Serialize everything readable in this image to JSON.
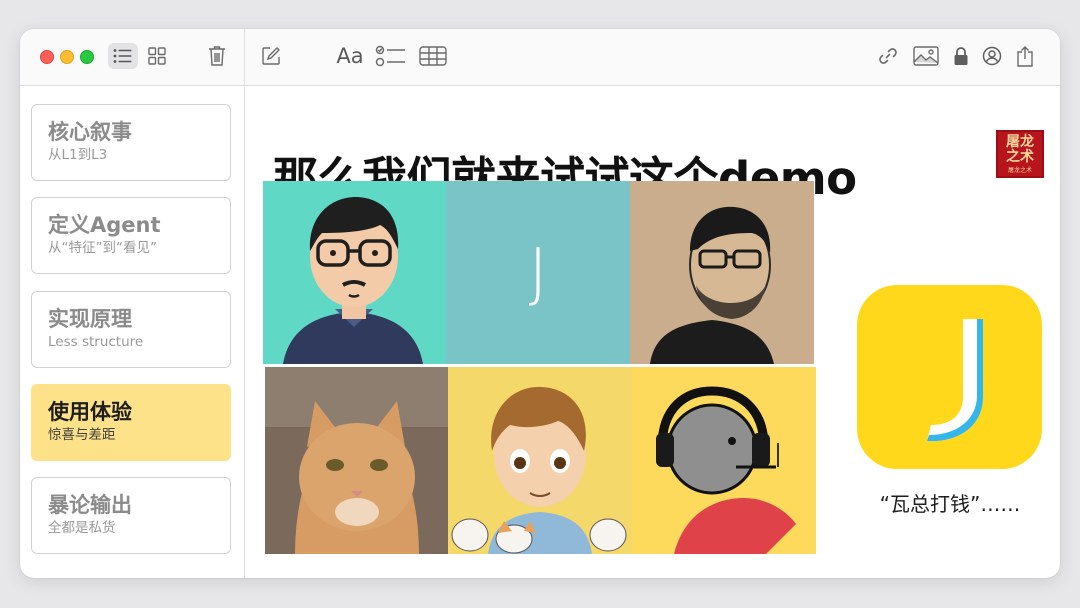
{
  "colors": {
    "selected_card": "#fde289",
    "app_icon_bg": "#ffd81c",
    "tile_teal": "#5fd9c6",
    "tile_blue": "#7ac3c6",
    "tile_yellow": "#fdd95c"
  },
  "toolbar": {
    "font_label": "Aa",
    "icons": [
      "list-view-icon",
      "gallery-view-icon",
      "trash-icon",
      "compose-icon",
      "format-icon",
      "checklist-icon",
      "table-icon",
      "link-icon",
      "media-icon",
      "lock-icon",
      "share-user-icon",
      "export-icon"
    ]
  },
  "sidebar": {
    "items": [
      {
        "title": "核心叙事",
        "subtitle": "从L1到L3"
      },
      {
        "title": "定义Agent",
        "subtitle": "从“特征”到“看见”"
      },
      {
        "title": "实现原理",
        "subtitle": "Less structure"
      },
      {
        "title": "使用体验",
        "subtitle": "惊喜与差距"
      },
      {
        "title": "暴论输出",
        "subtitle": "全都是私货"
      }
    ],
    "selected_index": 3
  },
  "main": {
    "heading": "那么我们就来试试这个demo",
    "stamp_line1": "屠龙",
    "stamp_line2": "之术",
    "stamp_small": "屠龙之术",
    "avatar_letter": "J",
    "caption": "“瓦总打钱”……"
  }
}
